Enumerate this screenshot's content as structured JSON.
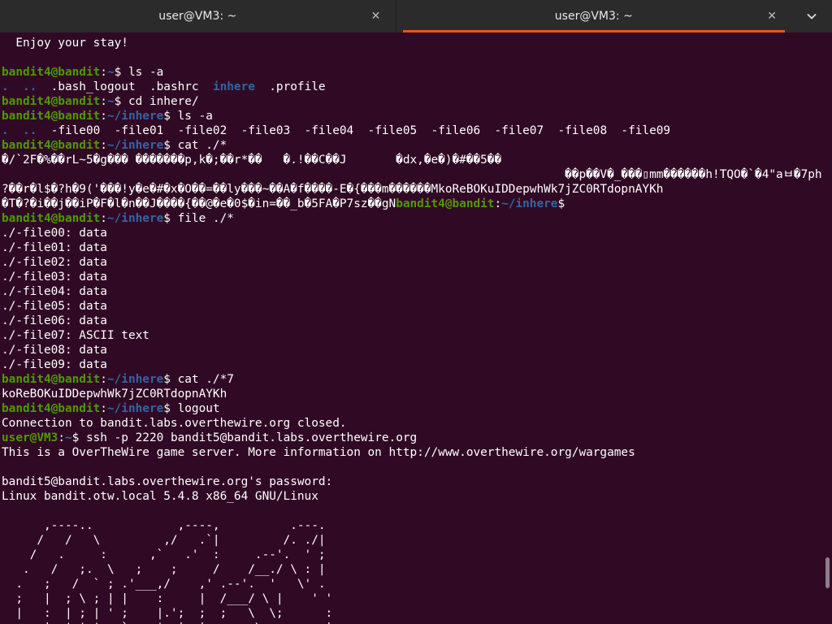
{
  "tabs": [
    {
      "title": "user@VM3: ~",
      "close": "✕"
    },
    {
      "title": "user@VM3: ~",
      "close": "✕"
    }
  ],
  "menu_icon": "chevron-down-icon",
  "colors": {
    "background": "#300a24",
    "prompt": "#4e9a06",
    "path": "#3465a4",
    "tab_accent": "#e95420"
  },
  "terminal": {
    "lines": [
      {
        "segments": [
          {
            "t": "  Enjoy your stay!"
          }
        ]
      },
      {
        "segments": [
          {
            "t": ""
          }
        ]
      },
      {
        "segments": [
          {
            "t": "bandit4@bandit",
            "c": "prompt-user"
          },
          {
            "t": ":"
          },
          {
            "t": "~",
            "c": "prompt-path"
          },
          {
            "t": "$ ls -a"
          }
        ]
      },
      {
        "segments": [
          {
            "t": ".",
            "c": "dir"
          },
          {
            "t": "  "
          },
          {
            "t": "..",
            "c": "dir"
          },
          {
            "t": "  .bash_logout  .bashrc  "
          },
          {
            "t": "inhere",
            "c": "dir"
          },
          {
            "t": "  .profile"
          }
        ]
      },
      {
        "segments": [
          {
            "t": "bandit4@bandit",
            "c": "prompt-user"
          },
          {
            "t": ":"
          },
          {
            "t": "~",
            "c": "prompt-path"
          },
          {
            "t": "$ cd inhere/"
          }
        ]
      },
      {
        "segments": [
          {
            "t": "bandit4@bandit",
            "c": "prompt-user"
          },
          {
            "t": ":"
          },
          {
            "t": "~/inhere",
            "c": "prompt-path"
          },
          {
            "t": "$ ls -a"
          }
        ]
      },
      {
        "segments": [
          {
            "t": ".",
            "c": "dir"
          },
          {
            "t": "  "
          },
          {
            "t": "..",
            "c": "dir"
          },
          {
            "t": "  -file00  -file01  -file02  -file03  -file04  -file05  -file06  -file07  -file08  -file09"
          }
        ]
      },
      {
        "segments": [
          {
            "t": "bandit4@bandit",
            "c": "prompt-user"
          },
          {
            "t": ":"
          },
          {
            "t": "~/inhere",
            "c": "prompt-path"
          },
          {
            "t": "$ cat ./*"
          }
        ]
      },
      {
        "segments": [
          {
            "t": "�/`2F�%��rL~5�g��� �������p,k�;��r*��   �.!��C��J       �dx,�e�)�#��5��"
          }
        ]
      },
      {
        "segments": [
          {
            "t": "                                                                                ��p��V�_���▯mm������h!TQO�`�4\"aㅂ�7phT��,"
          }
        ]
      },
      {
        "segments": [
          {
            "t": "?��r�l$�?h�9('���!y�e�#�x�O��=��ly���~��A�f����-E�{���m������MkoReBOKuIDDepwhWk7jZC0RTdopnAYKh"
          }
        ]
      },
      {
        "segments": [
          {
            "t": "�T�?�i��j��iP�F�l�n��J����{��@�e�0$�in=��_b�5FA�P7sz��gN"
          },
          {
            "t": "bandit4@bandit",
            "c": "prompt-user"
          },
          {
            "t": ":"
          },
          {
            "t": "~/inhere",
            "c": "prompt-path"
          },
          {
            "t": "$"
          }
        ]
      },
      {
        "segments": [
          {
            "t": "bandit4@bandit",
            "c": "prompt-user"
          },
          {
            "t": ":"
          },
          {
            "t": "~/inhere",
            "c": "prompt-path"
          },
          {
            "t": "$ file ./*"
          }
        ]
      },
      {
        "segments": [
          {
            "t": "./-file00: data"
          }
        ]
      },
      {
        "segments": [
          {
            "t": "./-file01: data"
          }
        ]
      },
      {
        "segments": [
          {
            "t": "./-file02: data"
          }
        ]
      },
      {
        "segments": [
          {
            "t": "./-file03: data"
          }
        ]
      },
      {
        "segments": [
          {
            "t": "./-file04: data"
          }
        ]
      },
      {
        "segments": [
          {
            "t": "./-file05: data"
          }
        ]
      },
      {
        "segments": [
          {
            "t": "./-file06: data"
          }
        ]
      },
      {
        "segments": [
          {
            "t": "./-file07: ASCII text"
          }
        ]
      },
      {
        "segments": [
          {
            "t": "./-file08: data"
          }
        ]
      },
      {
        "segments": [
          {
            "t": "./-file09: data"
          }
        ]
      },
      {
        "segments": [
          {
            "t": "bandit4@bandit",
            "c": "prompt-user"
          },
          {
            "t": ":"
          },
          {
            "t": "~/inhere",
            "c": "prompt-path"
          },
          {
            "t": "$ cat ./*7"
          }
        ]
      },
      {
        "segments": [
          {
            "t": "koReBOKuIDDepwhWk7jZC0RTdopnAYKh"
          }
        ]
      },
      {
        "segments": [
          {
            "t": "bandit4@bandit",
            "c": "prompt-user"
          },
          {
            "t": ":"
          },
          {
            "t": "~/inhere",
            "c": "prompt-path"
          },
          {
            "t": "$ logout"
          }
        ]
      },
      {
        "segments": [
          {
            "t": "Connection to bandit.labs.overthewire.org closed."
          }
        ]
      },
      {
        "segments": [
          {
            "t": "user@VM3",
            "c": "prompt-user"
          },
          {
            "t": ":"
          },
          {
            "t": "~",
            "c": "prompt-path"
          },
          {
            "t": "$ ssh -p 2220 bandit5@bandit.labs.overthewire.org"
          }
        ]
      },
      {
        "segments": [
          {
            "t": "This is a OverTheWire game server. More information on http://www.overthewire.org/wargames"
          }
        ]
      },
      {
        "segments": [
          {
            "t": ""
          }
        ]
      },
      {
        "segments": [
          {
            "t": "bandit5@bandit.labs.overthewire.org's password:"
          }
        ]
      },
      {
        "segments": [
          {
            "t": "Linux bandit.otw.local 5.4.8 x86_64 GNU/Linux"
          }
        ]
      },
      {
        "segments": [
          {
            "t": ""
          }
        ]
      },
      {
        "segments": [
          {
            "t": "      ,----..            ,----,          .---."
          }
        ]
      },
      {
        "segments": [
          {
            "t": "     /   /   \\         ,/   .`|         /. ./|"
          }
        ]
      },
      {
        "segments": [
          {
            "t": "    /   .     :      ,`   .'  :     .--'.  ' ;"
          }
        ]
      },
      {
        "segments": [
          {
            "t": "   .   /   ;.  \\   ;    ;     /    /__./ \\ : |"
          }
        ]
      },
      {
        "segments": [
          {
            "t": "  .   ;   /  ` ; .'___,/    ,' .--'.  '   \\' ."
          }
        ]
      },
      {
        "segments": [
          {
            "t": "  ;   |  ; \\ ; | |    :     |  /___/ \\ |    ' '"
          }
        ]
      },
      {
        "segments": [
          {
            "t": "  |   :  | ; | ' ;    |.';  ;  ;   \\  \\;      :"
          }
        ]
      },
      {
        "segments": [
          {
            "t": "  .   |  ' ' ' : `----'  |  |   ;   \\  ;      |"
          }
        ]
      }
    ]
  }
}
